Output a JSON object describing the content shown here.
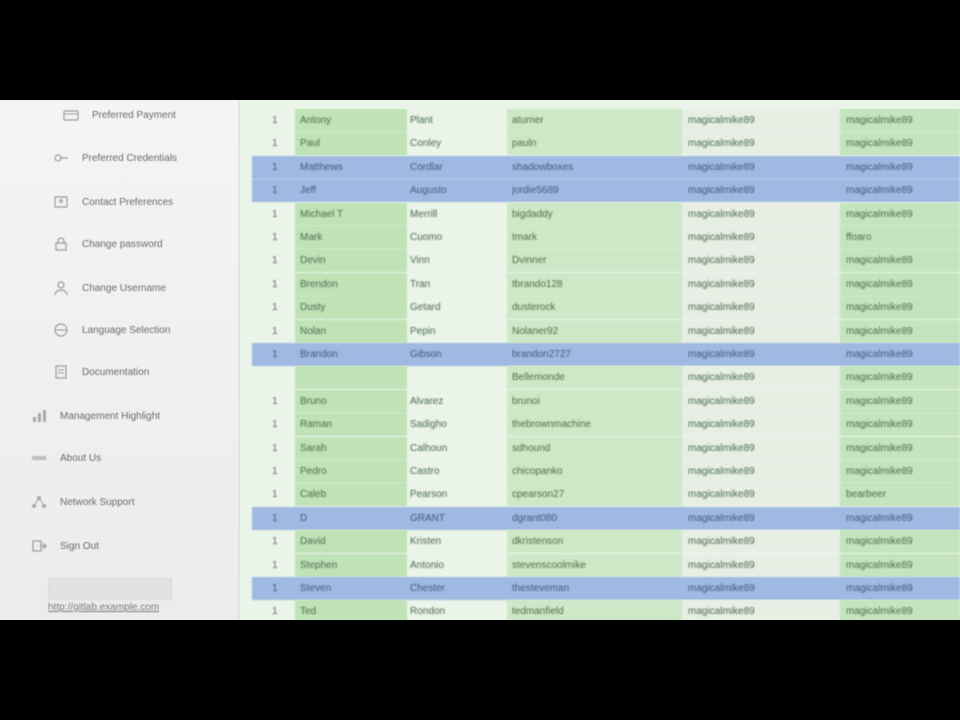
{
  "sidebar": {
    "items": [
      {
        "label": "Preferred Payment",
        "icon": "card-icon"
      },
      {
        "label": "Preferred Credentials",
        "icon": "key-icon"
      },
      {
        "label": "Contact Preferences",
        "icon": "contact-icon"
      },
      {
        "label": "Change password",
        "icon": "lock-icon"
      },
      {
        "label": "Change Username",
        "icon": "user-icon"
      },
      {
        "label": "Language Selection",
        "icon": "globe-icon"
      },
      {
        "label": "Documentation",
        "icon": "document-icon"
      },
      {
        "label": "Management Highlight",
        "icon": "chart-icon"
      },
      {
        "label": "About Us",
        "icon": "info-icon"
      },
      {
        "label": "Network Support",
        "icon": "network-icon"
      },
      {
        "label": "Sign Out",
        "icon": "exit-icon"
      }
    ],
    "bottom_link": "http://gitlab.example.com"
  },
  "table": {
    "rows": [
      {
        "num": "1",
        "first": "Antony",
        "last": "Plant",
        "user": "aturner",
        "pass1": "magicalmike89",
        "pass2": "magicalmike89",
        "selected": false
      },
      {
        "num": "1",
        "first": "Paul",
        "last": "Conley",
        "user": "pauln",
        "pass1": "magicalmike89",
        "pass2": "magicalmike89",
        "selected": false
      },
      {
        "num": "1",
        "first": "Matthews",
        "last": "Cordlar",
        "user": "shadowboxes",
        "pass1": "magicalmike89",
        "pass2": "magicalmike89",
        "selected": true
      },
      {
        "num": "1",
        "first": "Jeff",
        "last": "Augusto",
        "user": "jordie5689",
        "pass1": "magicalmike89",
        "pass2": "magicalmike89",
        "selected": true
      },
      {
        "num": "1",
        "first": "Michael T",
        "last": "Merrill",
        "user": "bigdaddy",
        "pass1": "magicalmike89",
        "pass2": "magicalmike89",
        "selected": false
      },
      {
        "num": "1",
        "first": "Mark",
        "last": "Cuomo",
        "user": "tmark",
        "pass1": "magicalmike89",
        "pass2": "ffoaro",
        "selected": false
      },
      {
        "num": "1",
        "first": "Devin",
        "last": "Vinn",
        "user": "Dvinner",
        "pass1": "magicalmike89",
        "pass2": "magicalmike89",
        "selected": false
      },
      {
        "num": "1",
        "first": "Brendon",
        "last": "Tran",
        "user": "tbrando128",
        "pass1": "magicalmike89",
        "pass2": "magicalmike89",
        "selected": false
      },
      {
        "num": "1",
        "first": "Dusty",
        "last": "Getard",
        "user": "dusterock",
        "pass1": "magicalmike89",
        "pass2": "magicalmike89",
        "selected": false
      },
      {
        "num": "1",
        "first": "Nolan",
        "last": "Pepin",
        "user": "Nolaner92",
        "pass1": "magicalmike89",
        "pass2": "magicalmike89",
        "selected": false
      },
      {
        "num": "1",
        "first": "Brandon",
        "last": "Gibson",
        "user": "brandon2727",
        "pass1": "magicalmike89",
        "pass2": "magicalmike89",
        "selected": true
      },
      {
        "num": "",
        "first": "",
        "last": "",
        "user": "Bellemonde",
        "pass1": "magicalmike89",
        "pass2": "magicalmike89",
        "selected": false
      },
      {
        "num": "1",
        "first": "Bruno",
        "last": "Alvarez",
        "user": "brunoi",
        "pass1": "magicalmike89",
        "pass2": "magicalmike89",
        "selected": false
      },
      {
        "num": "1",
        "first": "Raman",
        "last": "Sadigho",
        "user": "thebrownmachine",
        "pass1": "magicalmike89",
        "pass2": "magicalmike89",
        "selected": false
      },
      {
        "num": "1",
        "first": "Sarah",
        "last": "Calhoun",
        "user": "sdhound",
        "pass1": "magicalmike89",
        "pass2": "magicalmike89",
        "selected": false
      },
      {
        "num": "1",
        "first": "Pedro",
        "last": "Castro",
        "user": "chicopanko",
        "pass1": "magicalmike89",
        "pass2": "magicalmike89",
        "selected": false
      },
      {
        "num": "1",
        "first": "Caleb",
        "last": "Pearson",
        "user": "cpearson27",
        "pass1": "magicalmike89",
        "pass2": "bearbeer",
        "selected": false
      },
      {
        "num": "1",
        "first": "D",
        "last": "GRANT",
        "user": "dgrant080",
        "pass1": "magicalmike89",
        "pass2": "magicalmike89",
        "selected": true
      },
      {
        "num": "1",
        "first": "David",
        "last": "Kristen",
        "user": "dkristenson",
        "pass1": "magicalmike89",
        "pass2": "magicalmike89",
        "selected": false
      },
      {
        "num": "1",
        "first": "Stephen",
        "last": "Antonio",
        "user": "stevenscoolmike",
        "pass1": "magicalmike89",
        "pass2": "magicalmike89",
        "selected": false
      },
      {
        "num": "1",
        "first": "Steven",
        "last": "Chester",
        "user": "thesteveman",
        "pass1": "magicalmike89",
        "pass2": "magicalmike89",
        "selected": true
      },
      {
        "num": "1",
        "first": "Ted",
        "last": "Rondon",
        "user": "tedmanfield",
        "pass1": "magicalmike89",
        "pass2": "magicalmike89",
        "selected": false
      }
    ]
  }
}
